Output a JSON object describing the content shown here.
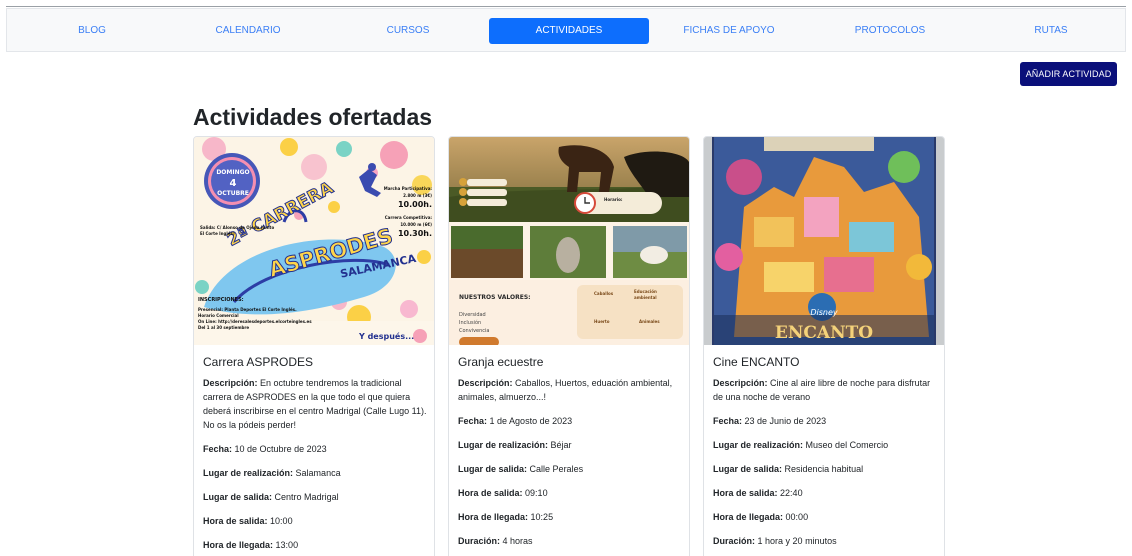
{
  "nav": {
    "items": [
      {
        "label": "BLOG",
        "active": false
      },
      {
        "label": "CALENDARIO",
        "active": false
      },
      {
        "label": "CURSOS",
        "active": false
      },
      {
        "label": "ACTIVIDADES",
        "active": true
      },
      {
        "label": "FICHAS DE APOYO",
        "active": false
      },
      {
        "label": "PROTOCOLOS",
        "active": false
      },
      {
        "label": "RUTAS",
        "active": false
      }
    ]
  },
  "add_button_label": "AÑADIR ACTIVIDAD",
  "page_title": "Actividades ofertadas",
  "field_labels": {
    "descripcion": "Descripción:",
    "fecha": "Fecha:",
    "lugar_realizacion": "Lugar de realización:",
    "lugar_salida": "Lugar de salida:",
    "hora_salida": "Hora de salida:",
    "hora_llegada": "Hora de llegada:",
    "duracion": "Duración:"
  },
  "cards": [
    {
      "title": "Carrera ASPRODES",
      "descripcion": "En octubre tendremos la tradicional carrera de ASPRODES en la que todo el que quiera deberá inscribirse en el centro Madrigal (Calle Lugo 11). No os la pódeis perder!",
      "fecha": "10 de Octubre de 2023",
      "lugar_realizacion": "Salamanca",
      "lugar_salida": "Centro Madrigal",
      "hora_salida": "10:00",
      "hora_llegada": "13:00",
      "poster": {
        "day_word": "DOMINGO",
        "day_num": "4",
        "month": "OCTUBRE",
        "title_a": "2ª CARRERA",
        "title_b": "ASPRODES",
        "city": "SALAMANCA",
        "march_label": "Marcha Participativa:",
        "march_dist": "2.800 m (3€)",
        "march_time": "10.00h.",
        "comp_label": "Carrera Competitiva:",
        "comp_dist": "10.000 m (6€)",
        "comp_time": "10.30h.",
        "exit": "Salida: C/ Alonso de Ojeda (junto El Corte Inglés)",
        "insc": "INSCRIPCIONES:",
        "pres": "Presencial: Planta Deportes El Corte Inglés.",
        "hor": "Horario Comercial",
        "online": "On Line: http://deresalesdeportes.elcorteingles.es",
        "dates": "Del 1 al 30 septiembre",
        "after": "Y después..."
      }
    },
    {
      "title": "Granja ecuestre",
      "descripcion": "Caballos, Huertos, eduación ambiental, animales, almuerzo...!",
      "fecha": "1 de Agosto de 2023",
      "lugar_realizacion": "Béjar",
      "lugar_salida": "Calle Perales",
      "hora_salida": "09:10",
      "hora_llegada": "10:25",
      "duracion": "4 horas",
      "poster": {
        "valores": "NUESTROS VALORES:",
        "v1": "Diversidad",
        "v2": "Inclusión",
        "v3": "Convivencia",
        "horario": "Horario:",
        "caballos": "Caballos",
        "educacion": "Educación ambiental",
        "huerto": "Huerto",
        "animales": "Animales"
      }
    },
    {
      "title": "Cine ENCANTO",
      "descripcion": "Cine al aire libre de noche para disfrutar de una noche de verano",
      "fecha": "23 de Junio de 2023",
      "lugar_realizacion": "Museo del Comercio",
      "lugar_salida": "Residencia habitual",
      "hora_salida": "22:40",
      "hora_llegada": "00:00",
      "duracion": "1 hora y 20 minutos",
      "poster": {
        "brand": "Disney",
        "title": "ENCANTO"
      }
    }
  ],
  "colors": {
    "nav_link": "#3b7ff5",
    "nav_active_bg": "#0d6efd",
    "add_button_bg": "#0a0f7a"
  }
}
